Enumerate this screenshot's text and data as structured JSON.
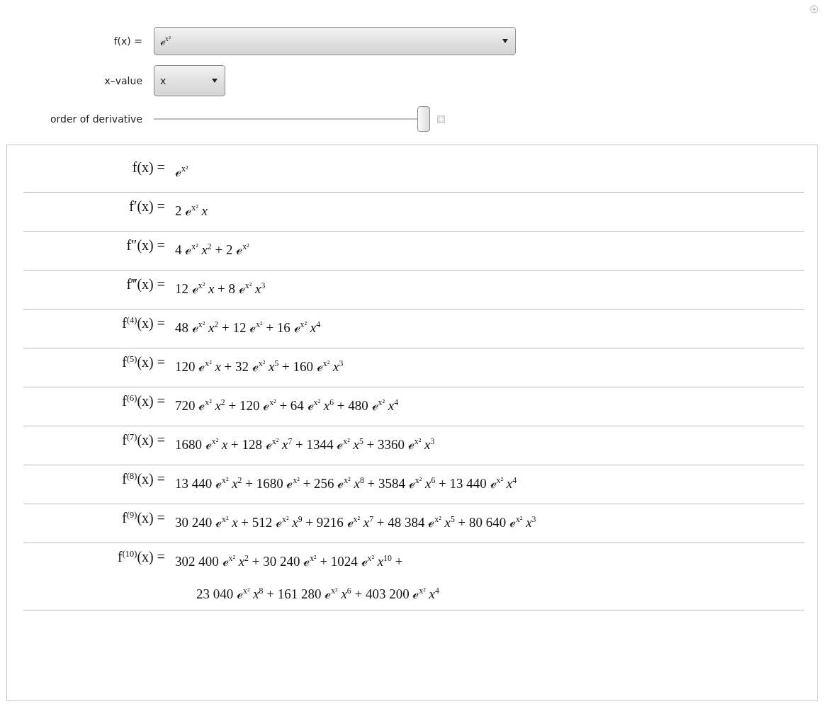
{
  "controls": {
    "function": {
      "label": "f(x) =",
      "value": "ℯ$^{x²}$"
    },
    "x_value": {
      "label": "x–value",
      "value": "x"
    },
    "order": {
      "label": "order of derivative",
      "level": 1.0
    }
  },
  "derivatives": [
    {
      "label": "f(x) =",
      "lines": [
        "ℯ$^{x²}$"
      ]
    },
    {
      "label": "f′(x) =",
      "lines": [
        "2 ℯ$^{x²}$ *x*"
      ]
    },
    {
      "label": "f″(x) =",
      "lines": [
        "4 ℯ$^{x²}$ *x*$^{2}$ + 2 ℯ$^{x²}$"
      ]
    },
    {
      "label": "f‴(x) =",
      "lines": [
        "12 ℯ$^{x²}$ *x* + 8 ℯ$^{x²}$ *x*$^{3}$"
      ]
    },
    {
      "label": "f$^{(4)}$(x) =",
      "lines": [
        "48 ℯ$^{x²}$ *x*$^{2}$ + 12 ℯ$^{x²}$ + 16 ℯ$^{x²}$ *x*$^{4}$"
      ]
    },
    {
      "label": "f$^{(5)}$(x) =",
      "lines": [
        "120 ℯ$^{x²}$ *x* + 32 ℯ$^{x²}$ *x*$^{5}$ + 160 ℯ$^{x²}$ *x*$^{3}$"
      ]
    },
    {
      "label": "f$^{(6)}$(x) =",
      "lines": [
        "720 ℯ$^{x²}$ *x*$^{2}$ + 120 ℯ$^{x²}$ + 64 ℯ$^{x²}$ *x*$^{6}$ + 480 ℯ$^{x²}$ *x*$^{4}$"
      ]
    },
    {
      "label": "f$^{(7)}$(x) =",
      "lines": [
        "1680 ℯ$^{x²}$ *x* + 128 ℯ$^{x²}$ *x*$^{7}$ + 1344 ℯ$^{x²}$ *x*$^{5}$ + 3360 ℯ$^{x²}$ *x*$^{3}$"
      ]
    },
    {
      "label": "f$^{(8)}$(x) =",
      "lines": [
        "13 440 ℯ$^{x²}$ *x*$^{2}$ + 1680 ℯ$^{x²}$ + 256 ℯ$^{x²}$ *x*$^{8}$ + 3584 ℯ$^{x²}$ *x*$^{6}$ + 13 440 ℯ$^{x²}$ *x*$^{4}$"
      ]
    },
    {
      "label": "f$^{(9)}$(x) =",
      "lines": [
        "30 240 ℯ$^{x²}$ *x* + 512 ℯ$^{x²}$ *x*$^{9}$ + 9216 ℯ$^{x²}$ *x*$^{7}$ + 48 384 ℯ$^{x²}$ *x*$^{5}$ + 80 640 ℯ$^{x²}$ *x*$^{3}$"
      ]
    },
    {
      "label": "f$^{(10)}$(x) =",
      "lines": [
        "302 400 ℯ$^{x²}$ *x*$^{2}$ + 30 240 ℯ$^{x²}$ + 1024 ℯ$^{x²}$ *x*$^{10}$ +",
        "23 040 ℯ$^{x²}$ *x*$^{8}$ + 161 280 ℯ$^{x²}$ *x*$^{6}$ + 403 200 ℯ$^{x²}$ *x*$^{4}$"
      ]
    }
  ]
}
